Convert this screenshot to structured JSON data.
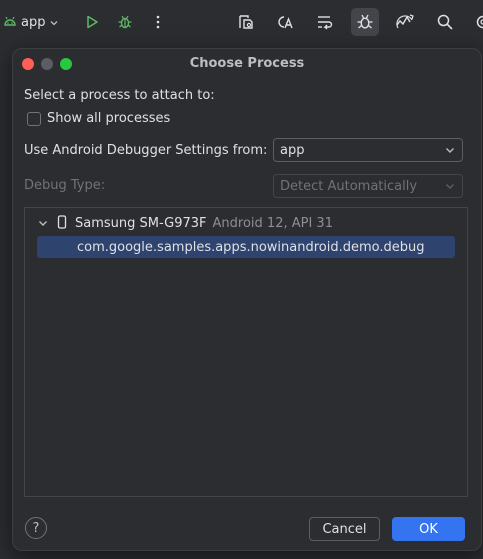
{
  "toolbar": {
    "run_config_label": "app",
    "icons": [
      "android-icon",
      "run-icon",
      "debug-icon",
      "more-icon",
      "layout-inspector-icon",
      "translate-icon",
      "apply-changes-icon",
      "attach-debugger-icon",
      "profiler-icon",
      "search-icon",
      "settings-icon"
    ]
  },
  "dialog": {
    "title": "Choose Process",
    "prompt": "Select a process to attach to:",
    "show_all_label": "Show all processes",
    "show_all_checked": false,
    "debugger_settings_label": "Use Android Debugger Settings from:",
    "debugger_settings_value": "app",
    "debug_type_label": "Debug Type:",
    "debug_type_value": "Detect Automatically",
    "device": {
      "name": "Samsung SM-G973F",
      "info": "Android 12, API 31"
    },
    "process": "com.google.samples.apps.nowinandroid.demo.debug",
    "help_label": "?",
    "cancel_label": "Cancel",
    "ok_label": "OK"
  },
  "colors": {
    "accent": "#3574f0",
    "selection": "#2e436e",
    "run_green": "#5fb865",
    "close": "#ff5f57",
    "zoom": "#28c840"
  }
}
